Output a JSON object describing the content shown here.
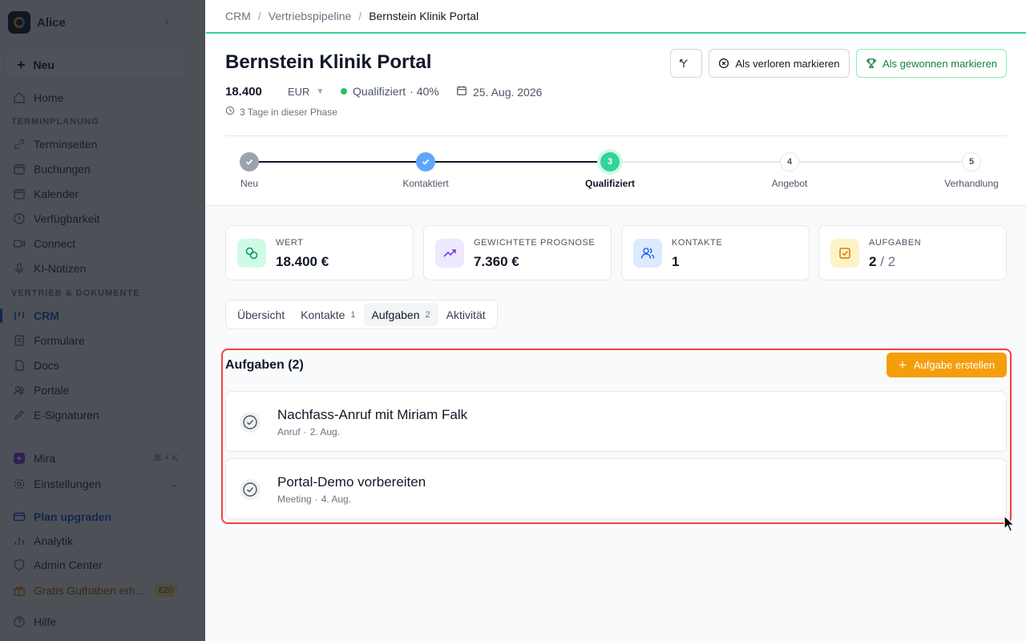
{
  "sidebar": {
    "workspace": "Alice",
    "new_label": "Neu",
    "home": "Home",
    "section_scheduling": "TERMINPLANUNG",
    "scheduling_items": [
      "Terminseiten",
      "Buchungen",
      "Kalender",
      "Verfügbarkeit",
      "Connect",
      "KI-Notizen"
    ],
    "section_sales": "VERTRIEB & DOKUMENTE",
    "sales_items": [
      "CRM",
      "Formulare",
      "Docs",
      "Portale",
      "E-Signaturen"
    ],
    "mira": "Mira",
    "mira_shortcut": "⌘ + K",
    "settings": "Einstellungen",
    "upgrade": "Plan upgraden",
    "analytics": "Analytik",
    "admin": "Admin Center",
    "credit": "Gratis Guthaben erh...",
    "credit_badge": "€20",
    "help": "Hilfe"
  },
  "breadcrumb": [
    "CRM",
    "Vertriebspipeline",
    "Bernstein Klinik Portal"
  ],
  "deal": {
    "title": "Bernstein Klinik Portal",
    "amount": "18.400",
    "currency": "EUR",
    "stage": "Qualifiziert",
    "probability": "· 40%",
    "close_date": "25. Aug. 2026",
    "days_in_phase": "3 Tage in dieser Phase"
  },
  "actions": {
    "lost": "Als verloren markieren",
    "won": "Als gewonnen markieren"
  },
  "stepper": [
    {
      "label": "Neu",
      "num": "1",
      "state": "done"
    },
    {
      "label": "Kontaktiert",
      "num": "2",
      "state": "done"
    },
    {
      "label": "Qualifiziert",
      "num": "3",
      "state": "current"
    },
    {
      "label": "Angebot",
      "num": "4",
      "state": "todo"
    },
    {
      "label": "Verhandlung",
      "num": "5",
      "state": "todo"
    }
  ],
  "stats": {
    "value": {
      "label": "WERT",
      "value": "18.400 €"
    },
    "forecast": {
      "label": "GEWICHTETE PROGNOSE",
      "value": "7.360 €"
    },
    "contacts": {
      "label": "KONTAKTE",
      "value": "1"
    },
    "tasks": {
      "label": "AUFGABEN",
      "done": "2",
      "total": "/ 2"
    }
  },
  "tabs": [
    {
      "label": "Übersicht",
      "count": ""
    },
    {
      "label": "Kontakte",
      "count": "1"
    },
    {
      "label": "Aufgaben",
      "count": "2"
    },
    {
      "label": "Aktivität",
      "count": ""
    }
  ],
  "tasks_section": {
    "title": "Aufgaben (2)",
    "create_label": "Aufgabe erstellen",
    "items": [
      {
        "title": "Nachfass-Anruf mit Miriam Falk",
        "type": "Anruf",
        "date": "2. Aug."
      },
      {
        "title": "Portal-Demo vorbereiten",
        "type": "Meeting",
        "date": "4. Aug."
      }
    ]
  },
  "colors": {
    "accent_green": "#22c55e",
    "accent_orange": "#f59e0b",
    "accent_blue": "#1d4ed8",
    "highlight_red": "#ef4444"
  }
}
